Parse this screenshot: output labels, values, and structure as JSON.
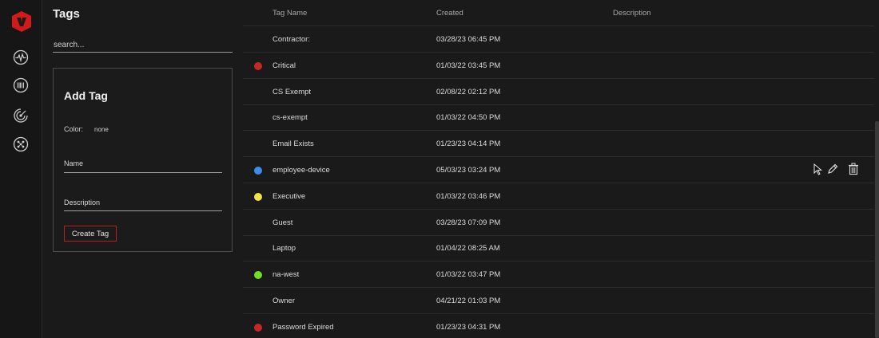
{
  "panel": {
    "title": "Tags",
    "search_placeholder": "search...",
    "add_tag": {
      "heading": "Add Tag",
      "color_label": "Color:",
      "color_value": "none",
      "name_label": "Name",
      "description_label": "Description",
      "create_button": "Create Tag"
    }
  },
  "table": {
    "columns": [
      "Tag Name",
      "Created",
      "Description"
    ],
    "rows": [
      {
        "name": "Contractor:",
        "created": "03/28/23 06:45 PM",
        "color": ""
      },
      {
        "name": "Critical",
        "created": "01/03/22 03:45 PM",
        "color": "#c62828"
      },
      {
        "name": "CS Exempt",
        "created": "02/08/22 02:12 PM",
        "color": ""
      },
      {
        "name": "cs-exempt",
        "created": "01/03/22 04:50 PM",
        "color": ""
      },
      {
        "name": "Email Exists",
        "created": "01/23/23 04:14 PM",
        "color": ""
      },
      {
        "name": "employee-device",
        "created": "05/03/23 03:24 PM",
        "color": "#3b8ee8"
      },
      {
        "name": "Executive",
        "created": "01/03/22 03:46 PM",
        "color": "#f2e34a"
      },
      {
        "name": "Guest",
        "created": "03/28/23 07:09 PM",
        "color": ""
      },
      {
        "name": "Laptop",
        "created": "01/04/22 08:25 AM",
        "color": ""
      },
      {
        "name": "na-west",
        "created": "01/03/22 03:47 PM",
        "color": "#6fe028"
      },
      {
        "name": "Owner",
        "created": "04/21/22 01:03 PM",
        "color": ""
      },
      {
        "name": "Password Expired",
        "created": "01/23/23 04:31 PM",
        "color": "#c62828"
      }
    ]
  },
  "icons": {
    "logo": "brand-logo-icon",
    "nav": [
      "activity-pulse-icon",
      "barcode-icon",
      "radar-icon",
      "network-globe-icon"
    ],
    "row_actions": [
      "pointer-cursor-icon",
      "edit-pencil-icon",
      "trash-icon"
    ]
  },
  "colors": {
    "accent": "#b52020",
    "background": "#1a1a1a"
  }
}
